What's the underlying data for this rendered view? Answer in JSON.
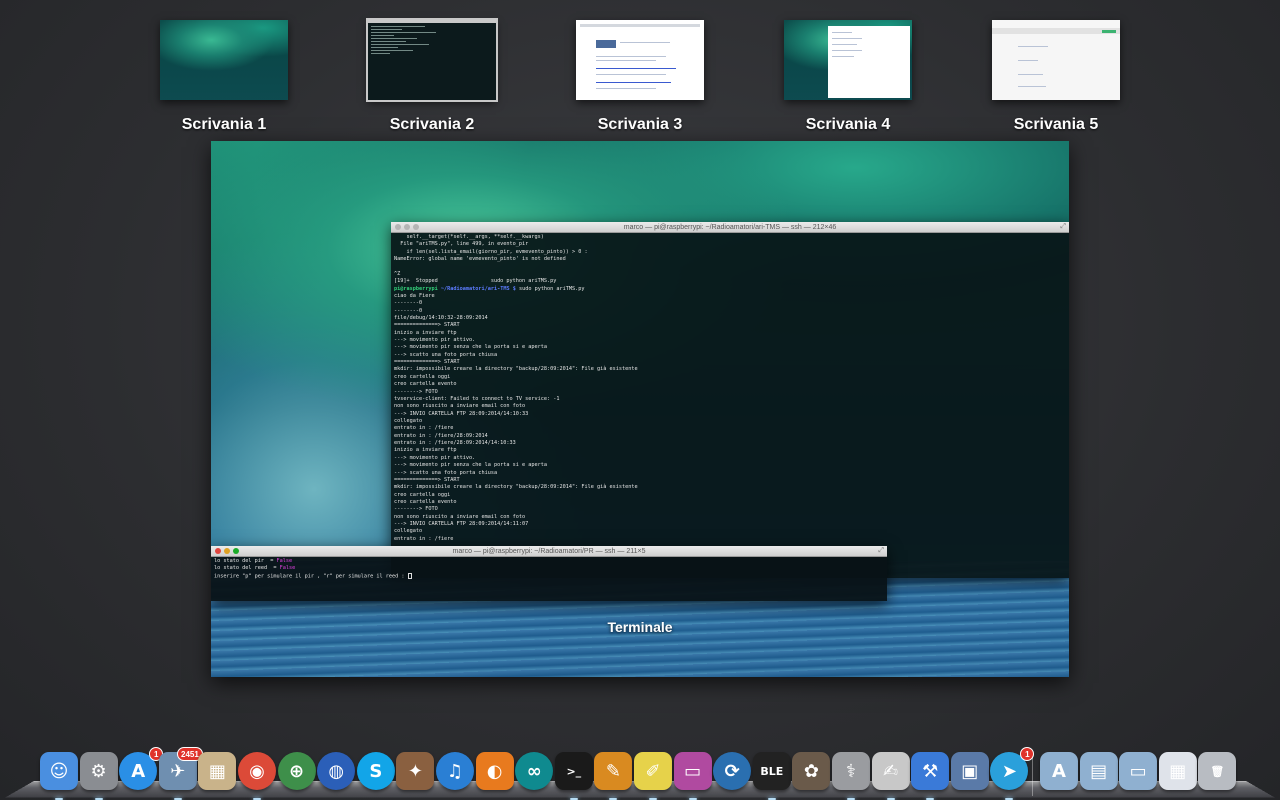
{
  "spaces": [
    {
      "label": "Scrivania 1",
      "active": false
    },
    {
      "label": "Scrivania 2",
      "active": true
    },
    {
      "label": "Scrivania 3",
      "active": false
    },
    {
      "label": "Scrivania 4",
      "active": false
    },
    {
      "label": "Scrivania 5",
      "active": false
    }
  ],
  "window_label": "Terminale",
  "term_main": {
    "title": "marco — pi@raspberrypi: ~/Radioamatori/ari-TMS — ssh — 212×46",
    "lines": [
      "    self.__target(*self.__args, **self.__kwargs)",
      "  File \"ariTMS.py\", line 499, in evento_pir",
      "    if len(sel.lista_email(giorno_pir, evmevento_pinto)) > 0 :",
      "NameError: global name 'evmevento_pinto' is not defined",
      "",
      "^Z",
      "[19]+  Stopped                 sudo python ariTMS.py",
      "pi@raspberrypi ~/Radioamatori/ari-TMS $ sudo python ariTMS.py",
      "ciao da Fiere",
      "--------0",
      "--------0",
      "file/debug/14:10:32-28:09:2014",
      "==============> START",
      "inizio a inviare ftp",
      "---> movimento pir attivo.",
      "---> movimento pir senza che la porta si e aperta",
      "---> scatto una foto porta chiusa",
      "==============> START",
      "mkdir: impossibile creare la directory \"backup/28:09:2014\": File già esistente",
      "creo cartella oggi",
      "creo cartella evento",
      "--------> FOTO",
      "tvservice-client: Failed to connect to TV service: -1",
      "non sono riuscito a inviare email con foto",
      "---> INVIO CARTELLA FTP 28:09:2014/14:10:33",
      "collegato",
      "entrato in : /fiere",
      "entrato in : /fiere/28:09:2014",
      "entrato in : /fiere/28:09:2014/14:10:33",
      "inizio a inviare ftp",
      "---> movimento pir attivo.",
      "---> movimento pir senza che la porta si e aperta",
      "---> scatto una foto porta chiusa",
      "==============> START",
      "mkdir: impossibile creare la directory \"backup/28:09:2014\": File già esistente",
      "creo cartella oggi",
      "creo cartella evento",
      "--------> FOTO",
      "non sono riuscito a inviare email con foto",
      "---> INVIO CARTELLA FTP 28:09:2014/14:11:07",
      "collegato",
      "entrato in : /fiere",
      "",
      "inizio a inviare ftp"
    ]
  },
  "term_small": {
    "title": "marco — pi@raspberrypi: ~/Radioamatori/PR — ssh — 211×5",
    "lines": [
      {
        "text": "lo stato del pir  = ",
        "value": "False"
      },
      {
        "text": "lo stato del reed  = ",
        "value": "False"
      },
      {
        "text": "inserire \"p\" per simulare il pir , \"r\" per simulare il reed : ",
        "value": ""
      }
    ]
  },
  "dock": {
    "badges": {
      "app_store": "1",
      "mail": "2451",
      "telegram": "1"
    },
    "apps": [
      {
        "name": "finder-icon",
        "glyph": "☺",
        "color": "#4a8fe0"
      },
      {
        "name": "system-preferences-icon",
        "glyph": "⚙",
        "color": "#8a8d92"
      },
      {
        "name": "app-store-icon",
        "glyph": "A",
        "color": "#2a8fe6",
        "badge": "app_store"
      },
      {
        "name": "mail-icon",
        "glyph": "✈",
        "color": "#6f8fb0",
        "badge": "mail"
      },
      {
        "name": "preview-icon",
        "glyph": "▦",
        "color": "#c9b38a"
      },
      {
        "name": "chrome-icon",
        "glyph": "◉",
        "color": "#dc4a38"
      },
      {
        "name": "globe-icon",
        "glyph": "⊕",
        "color": "#3e8f4a"
      },
      {
        "name": "google-earth-icon",
        "glyph": "◍",
        "color": "#2b5fb8"
      },
      {
        "name": "skype-icon",
        "glyph": "S",
        "color": "#12a5e8"
      },
      {
        "name": "joystick-icon",
        "glyph": "✦",
        "color": "#8a6040"
      },
      {
        "name": "itunes-icon",
        "glyph": "♫",
        "color": "#2a7fd4"
      },
      {
        "name": "blender-icon",
        "glyph": "◐",
        "color": "#e87a1e"
      },
      {
        "name": "arduino-icon",
        "glyph": "∞",
        "color": "#0f8a8f"
      },
      {
        "name": "terminal-icon",
        "glyph": ">_",
        "color": "#1a1a1a"
      },
      {
        "name": "textedit-icon",
        "glyph": "✎",
        "color": "#d98a20"
      },
      {
        "name": "stickies-icon",
        "glyph": "✐",
        "color": "#e6d24a"
      },
      {
        "name": "display-icon",
        "glyph": "▭",
        "color": "#b04aa0"
      },
      {
        "name": "sync-icon",
        "glyph": "⟳",
        "color": "#2a6fb0"
      },
      {
        "name": "ble-icon",
        "glyph": "BLE",
        "color": "#222222"
      },
      {
        "name": "gimp-icon",
        "glyph": "✿",
        "color": "#6a5a4a"
      },
      {
        "name": "disk-utility-icon",
        "glyph": "⚕",
        "color": "#9a9ca0"
      },
      {
        "name": "script-editor-icon",
        "glyph": "✍",
        "color": "#c8c8c8"
      },
      {
        "name": "xcode-icon",
        "glyph": "⚒",
        "color": "#3a7ad8"
      },
      {
        "name": "photos-icon",
        "glyph": "▣",
        "color": "#5a7aa8"
      },
      {
        "name": "telegram-icon",
        "glyph": "➤",
        "color": "#2aa0db",
        "badge": "telegram"
      },
      {
        "name": "applications-folder-icon",
        "glyph": "A",
        "color": "#8fb0d0"
      },
      {
        "name": "documents-folder-icon",
        "glyph": "▤",
        "color": "#8fb0d0"
      },
      {
        "name": "downloads-folder-icon",
        "glyph": "▭",
        "color": "#8fb0d0"
      },
      {
        "name": "screenshot-stack-icon",
        "glyph": "▦",
        "color": "#dfe3ea"
      },
      {
        "name": "trash-icon",
        "glyph": "🗑",
        "color": "#b8bcc2"
      }
    ]
  }
}
